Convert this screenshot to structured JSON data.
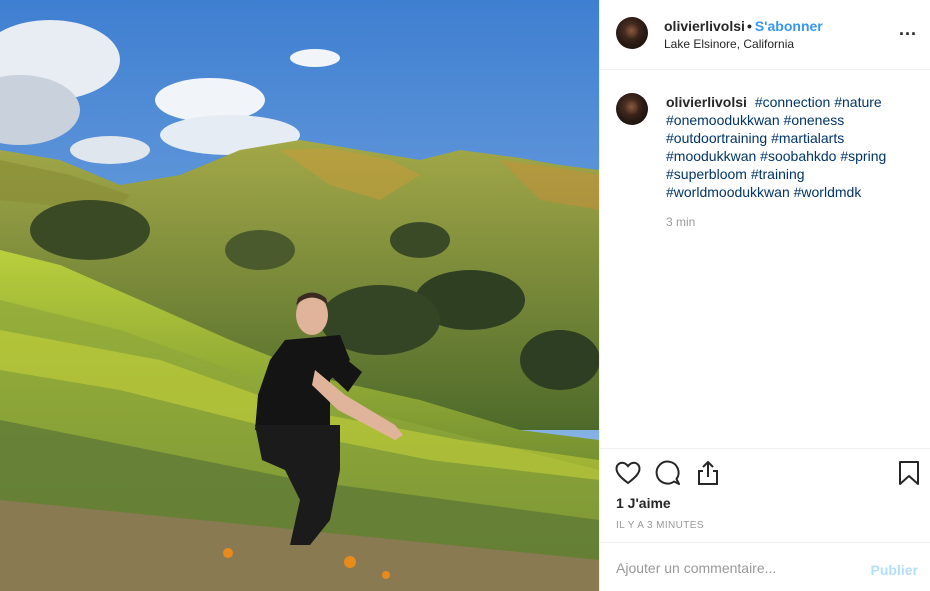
{
  "header": {
    "username": "olivierlivolsi",
    "separator": "•",
    "follow_label": "S'abonner",
    "location": "Lake Elsinore, California",
    "more_label": "..."
  },
  "caption": {
    "author": "olivierlivolsi",
    "hashtags": [
      "#connection",
      "#nature",
      "#onemoodukkwan",
      "#oneness",
      "#outdoortraining",
      "#martialarts",
      "#moodukkwan",
      "#soobahkdo",
      "#spring",
      "#superbloom",
      "#training",
      "#worldmoodukkwan",
      "#worldmdk"
    ],
    "time": "3 min"
  },
  "actions": {
    "icons": [
      "heart-icon",
      "comment-icon",
      "share-icon",
      "bookmark-icon"
    ]
  },
  "likes_label": "1 J'aime",
  "time_ago": "IL Y A 3 MINUTES",
  "comment": {
    "placeholder": "Ajouter un commentaire...",
    "publish_label": "Publier"
  },
  "colors": {
    "follow": "#3897f0",
    "hashtag": "#003569",
    "publish_disabled": "#b2dffc",
    "muted": "#999999",
    "divider": "#efefef"
  }
}
